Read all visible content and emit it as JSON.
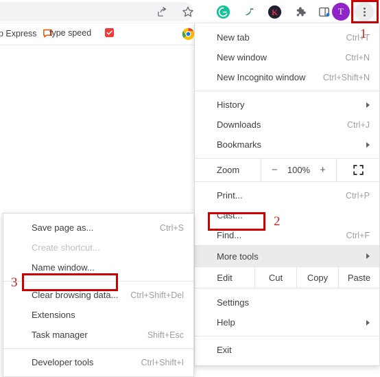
{
  "toolbar": {
    "icons": [
      {
        "name": "share-icon",
        "label": "Share this page"
      },
      {
        "name": "bookmark-star-icon",
        "label": "Bookmark this tab"
      },
      {
        "name": "grammarly-extension-icon",
        "label": "Grammarly"
      },
      {
        "name": "kiwi-extension-icon",
        "label": "Extension"
      },
      {
        "name": "k-extension-icon",
        "label": "Extension K"
      },
      {
        "name": "puzzle-extensions-icon",
        "label": "Extensions"
      },
      {
        "name": "side-panel-icon",
        "label": "Side panel"
      }
    ],
    "profile_initial": "T",
    "profile_color": "#8e24c9",
    "menu_button_label": "Customize and control Google Chrome"
  },
  "bookmarks_bar": {
    "items": [
      {
        "name": "bookmark-app-express",
        "label": "pp Express",
        "icon": "orange-chat-icon"
      },
      {
        "name": "bookmark-type-speed",
        "label": "type speed",
        "icon": "red-check-icon"
      }
    ]
  },
  "chrome_menu": {
    "groups": [
      {
        "items": [
          {
            "label": "New tab",
            "accel": "Ctrl+T",
            "name": "menu-item-new-tab",
            "caret": false
          },
          {
            "label": "New window",
            "accel": "Ctrl+N",
            "name": "menu-item-new-window",
            "caret": false
          },
          {
            "label": "New Incognito window",
            "accel": "Ctrl+Shift+N",
            "name": "menu-item-new-incognito-window",
            "caret": false
          }
        ]
      },
      {
        "items": [
          {
            "label": "History",
            "accel": "",
            "name": "menu-item-history",
            "caret": true
          },
          {
            "label": "Downloads",
            "accel": "Ctrl+J",
            "name": "menu-item-downloads",
            "caret": false
          },
          {
            "label": "Bookmarks",
            "accel": "",
            "name": "menu-item-bookmarks",
            "caret": true
          }
        ]
      }
    ],
    "zoom": {
      "label": "Zoom",
      "minus": "−",
      "level": "100%",
      "plus": "+",
      "fullscreen_name": "fullscreen-icon"
    },
    "group3": [
      {
        "label": "Print...",
        "accel": "Ctrl+P",
        "name": "menu-item-print",
        "caret": false
      },
      {
        "label": "Cast...",
        "accel": "",
        "name": "menu-item-cast",
        "caret": false
      },
      {
        "label": "Find...",
        "accel": "Ctrl+F",
        "name": "menu-item-find",
        "caret": false
      }
    ],
    "more_tools": {
      "label": "More tools",
      "accel": "",
      "name": "menu-item-more-tools",
      "caret": true
    },
    "edit_row": {
      "edit": "Edit",
      "cut": "Cut",
      "copy": "Copy",
      "paste": "Paste"
    },
    "group4": [
      {
        "label": "Settings",
        "accel": "",
        "name": "menu-item-settings",
        "caret": false
      },
      {
        "label": "Help",
        "accel": "",
        "name": "menu-item-help",
        "caret": true
      }
    ],
    "group5": [
      {
        "label": "Exit",
        "accel": "",
        "name": "menu-item-exit",
        "caret": false
      }
    ]
  },
  "more_tools_submenu": {
    "group1": [
      {
        "label": "Save page as...",
        "accel": "Ctrl+S",
        "name": "submenu-item-save-page-as",
        "disabled": false
      },
      {
        "label": "Create shortcut...",
        "accel": "",
        "name": "submenu-item-create-shortcut",
        "disabled": true
      },
      {
        "label": "Name window...",
        "accel": "",
        "name": "submenu-item-name-window",
        "disabled": false
      }
    ],
    "group2": [
      {
        "label": "Clear browsing data...",
        "accel": "Ctrl+Shift+Del",
        "name": "submenu-item-clear-browsing-data",
        "disabled": false
      },
      {
        "label": "Extensions",
        "accel": "",
        "name": "submenu-item-extensions",
        "disabled": false
      },
      {
        "label": "Task manager",
        "accel": "Shift+Esc",
        "name": "submenu-item-task-manager",
        "disabled": false
      }
    ],
    "group3": [
      {
        "label": "Developer tools",
        "accel": "Ctrl+Shift+I",
        "name": "submenu-item-developer-tools",
        "disabled": false
      }
    ]
  },
  "annotations": {
    "highlight_color": "#cc0000",
    "steps": [
      {
        "number": "1",
        "target": "three-dot-menu-button"
      },
      {
        "number": "2",
        "target": "More tools"
      },
      {
        "number": "3",
        "target": "Clear browsing data..."
      }
    ]
  }
}
